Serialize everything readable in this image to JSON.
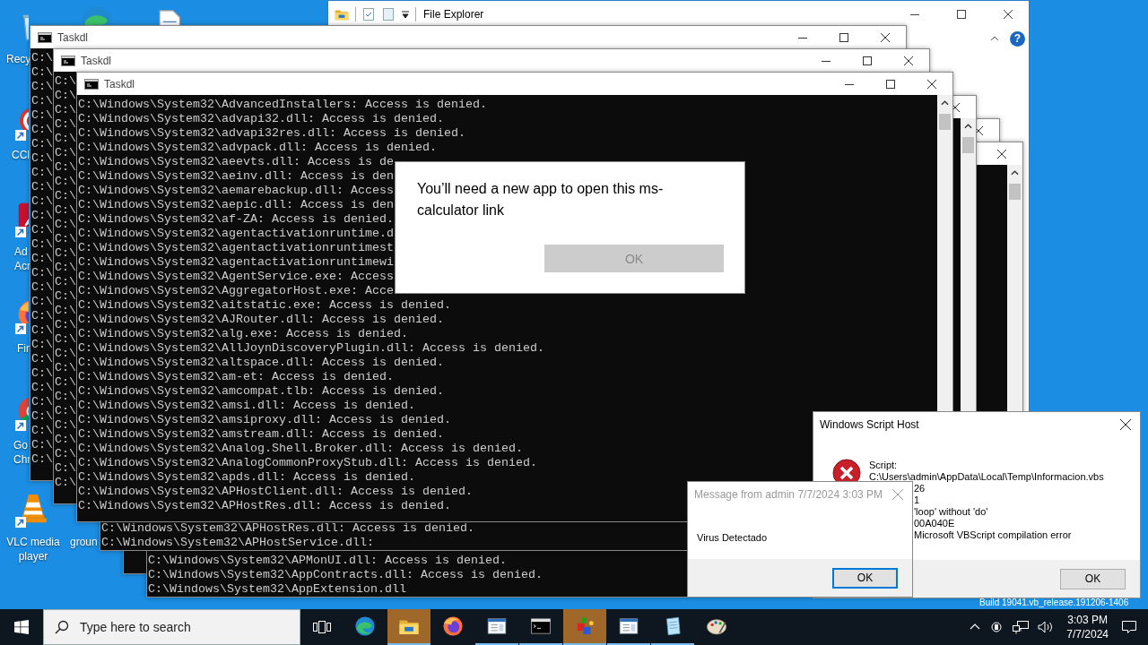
{
  "desktop_icons": [
    {
      "kind": "recycle",
      "label": [
        "Recy"
      ]
    },
    {
      "kind": "ccleaner",
      "label": [
        "CCl"
      ],
      "shortcut": true
    },
    {
      "kind": "acrobat",
      "label": [
        "Ad",
        "Acr"
      ],
      "shortcut": true
    },
    {
      "kind": "firefox",
      "label": [
        "Fir"
      ],
      "shortcut": true
    },
    {
      "kind": "chrome",
      "label": [
        "Go",
        "Chr"
      ],
      "shortcut": true
    },
    {
      "kind": "vlc",
      "label": [
        "VLC media",
        "player"
      ],
      "shortcut": true
    },
    {
      "kind": "edge"
    },
    {
      "kind": "document"
    },
    {
      "kind": "none",
      "label": [
        "groun"
      ]
    }
  ],
  "file_explorer": {
    "title": "File Explorer",
    "help": "?"
  },
  "consoles": [
    {
      "kind": "console",
      "title": "Taskdl",
      "lines": [
        "C:\\",
        "C:\\",
        "C:\\",
        "C:\\",
        "C:\\",
        "C:\\",
        "C:\\",
        "C:\\",
        "C:\\",
        "C:\\",
        "C:\\",
        "C:\\",
        "C:\\",
        "C:\\",
        "C:\\",
        "C:\\",
        "C:\\",
        "C:\\",
        "C:\\",
        "C:\\",
        "C:\\",
        "C:\\",
        "C:\\",
        "C:\\",
        "C:\\",
        "C:\\",
        "C:\\",
        "C:\\",
        "C:\\"
      ]
    },
    {
      "kind": "console",
      "title": "Taskdl",
      "lines": [
        "C:\\",
        "C:\\",
        "C:\\",
        "C:\\",
        "C:\\",
        "C:\\",
        "C:\\",
        "C:\\",
        "C:\\",
        "C:\\",
        "C:\\",
        "C:\\",
        "C:\\",
        "C:\\",
        "C:\\",
        "C:\\",
        "C:\\",
        "C:\\",
        "C:\\",
        "C:\\",
        "C:\\",
        "C:\\",
        "C:\\",
        "C:\\",
        "C:\\",
        "C:\\",
        "C:\\",
        "C:\\",
        "C:\\"
      ]
    },
    {
      "kind": "console",
      "title": "Taskdl",
      "scrollbar": true,
      "lines": [
        "C:\\Windows\\System32\\AdvancedInstallers: Access is denied.",
        "C:\\Windows\\System32\\advapi32.dll: Access is denied.",
        "C:\\Windows\\System32\\advapi32res.dll: Access is denied.",
        "C:\\Windows\\System32\\advpack.dll: Access is denied.",
        "C:\\Windows\\System32\\aeevts.dll: Access is de",
        "C:\\Windows\\System32\\aeinv.dll: Access is den",
        "C:\\Windows\\System32\\aemarebackup.dll: Access",
        "C:\\Windows\\System32\\aepic.dll: Access is den",
        "C:\\Windows\\System32\\af-ZA: Access is denied.",
        "C:\\Windows\\System32\\agentactivationruntime.d",
        "C:\\Windows\\System32\\agentactivationruntimest",
        "C:\\Windows\\System32\\agentactivationruntimewi",
        "C:\\Windows\\System32\\AgentService.exe: Access",
        "C:\\Windows\\System32\\AggregatorHost.exe: Acce",
        "C:\\Windows\\System32\\aitstatic.exe: Access is denied.",
        "C:\\Windows\\System32\\AJRouter.dll: Access is denied.",
        "C:\\Windows\\System32\\alg.exe: Access is denied.",
        "C:\\Windows\\System32\\AllJoynDiscoveryPlugin.dll: Access is denied.",
        "C:\\Windows\\System32\\altspace.dll: Access is denied.",
        "C:\\Windows\\System32\\am-et: Access is denied.",
        "C:\\Windows\\System32\\amcompat.tlb: Access is denied.",
        "C:\\Windows\\System32\\amsi.dll: Access is denied.",
        "C:\\Windows\\System32\\amsiproxy.dll: Access is denied.",
        "C:\\Windows\\System32\\amstream.dll: Access is denied.",
        "C:\\Windows\\System32\\Analog.Shell.Broker.dll: Access is denied.",
        "C:\\Windows\\System32\\AnalogCommonProxyStub.dll: Access is denied.",
        "C:\\Windows\\System32\\apds.dll: Access is denied.",
        "C:\\Windows\\System32\\APHostClient.dll: Access is denied.",
        "C:\\Windows\\System32\\APHostRes.dll: Access is denied."
      ]
    },
    {
      "kind": "console",
      "scrollbar": true,
      "lines": [
        "C:\\Windows\\System32\\APHostRes.dll: Access is denied.",
        "C:\\Windows\\System32\\APHostService.dll:"
      ]
    },
    {
      "kind": "console"
    },
    {
      "kind": "console",
      "scrollbar": true,
      "lines": [
        "C:\\Windows\\System32\\APMonUI.dll: Access is denied.",
        "C:\\Windows\\System32\\AppContracts.dll: Access is denied.",
        "C:\\Windows\\System32\\AppExtension.dll"
      ]
    }
  ],
  "app_dialog": {
    "message": "You’ll need a new app to open this ms-calculator link",
    "button": {
      "label": "OK",
      "disabled": true
    }
  },
  "script_error": {
    "title": "Windows Script Host",
    "label": "Script:",
    "path": "C:\\Users\\admin\\AppData\\Local\\Temp\\Informacion.vbs",
    "values": [
      "26",
      "1",
      "'loop' without 'do'",
      "00A040E",
      "Microsoft VBScript compilation error"
    ],
    "button": "OK"
  },
  "message_box": {
    "title": "Message from admin 7/7/2024 3:03 PM",
    "message": "Virus Detectado",
    "button": "OK"
  },
  "build_text": "Build 19041.vb_release.191206-1406",
  "taskbar": {
    "search": {
      "placeholder": "Type here to search"
    },
    "apps": [
      {
        "kind": "edge",
        "running": false,
        "flashing": false
      },
      {
        "kind": "explorer",
        "running": true,
        "flashing": true
      },
      {
        "kind": "firefox",
        "running": false,
        "flashing": false
      },
      {
        "kind": "window-app",
        "running": true,
        "flashing": false
      },
      {
        "kind": "console",
        "running": true,
        "flashing": false
      },
      {
        "kind": "tool",
        "running": true,
        "flashing": true
      },
      {
        "kind": "window-app",
        "running": true,
        "flashing": false
      },
      {
        "kind": "notepad",
        "running": true,
        "flashing": false
      },
      {
        "kind": "paint",
        "running": false,
        "flashing": false
      }
    ],
    "clock": {
      "time": "3:03 PM",
      "date": "7/7/2024"
    }
  }
}
